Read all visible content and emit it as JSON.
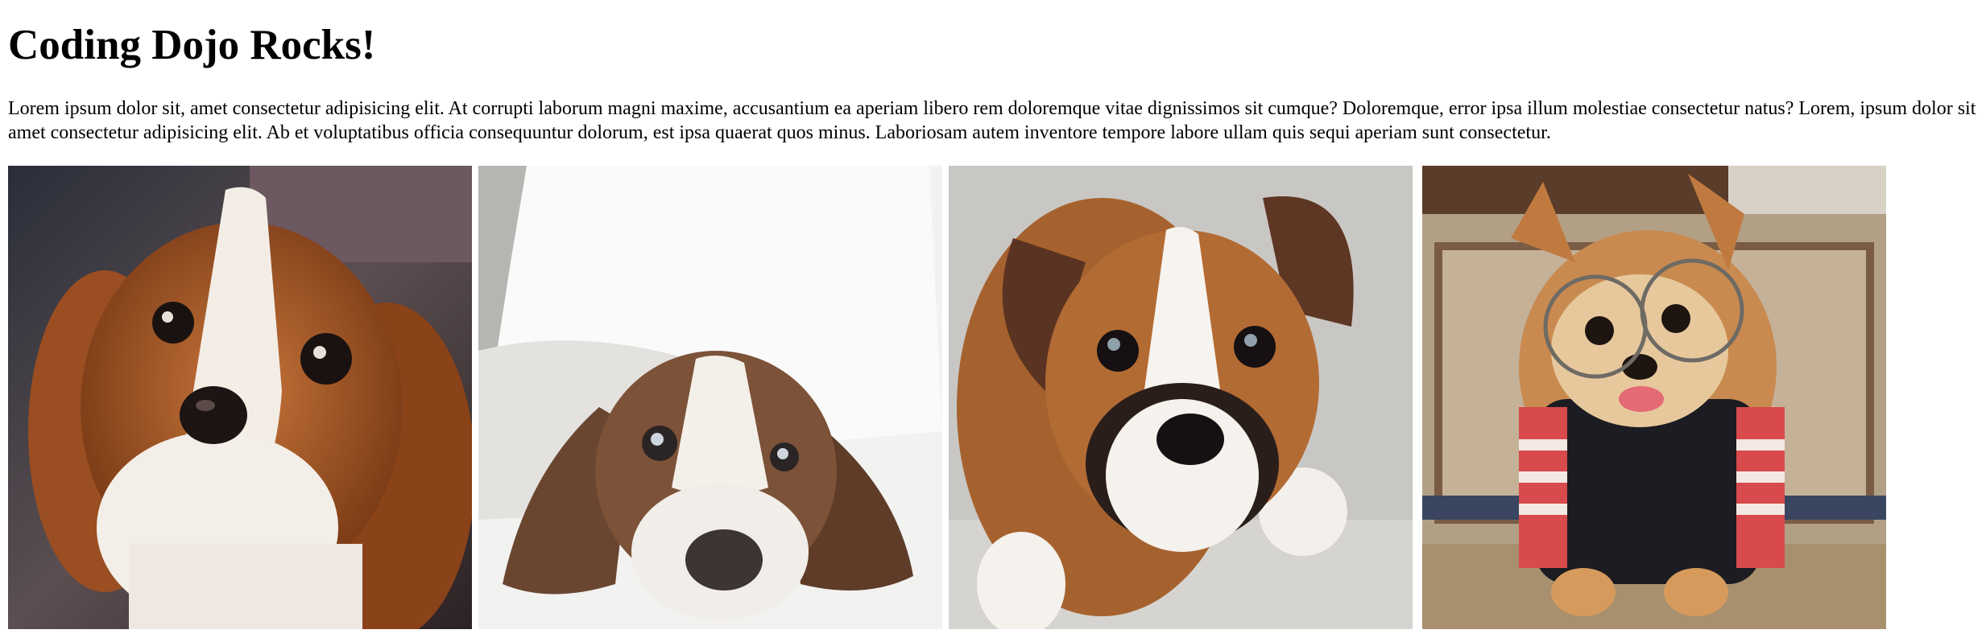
{
  "page": {
    "heading": "Coding Dojo Rocks!",
    "intro": "Lorem ipsum dolor sit, amet consectetur adipisicing elit. At corrupti laborum magni maxime, accusantium ea aperiam libero rem doloremque vitae dignissimos sit cumque? Doloremque, error ipsa illum molestiae consectetur natus? Lorem, ipsum dolor sit amet consectetur adipisicing elit. Ab et voluptatibus officia consequuntur dolorum, est ipsa quaerat quos minus. Laboriosam autem inventore tempore labore ullam quis sequi aperiam sunt consectetur."
  },
  "gallery": {
    "photos": [
      {
        "name": "cavalier-puppy-photo"
      },
      {
        "name": "basset-puppy-photo"
      },
      {
        "name": "boxer-puppy-photo"
      },
      {
        "name": "pomeranian-glasses-photo"
      }
    ]
  }
}
